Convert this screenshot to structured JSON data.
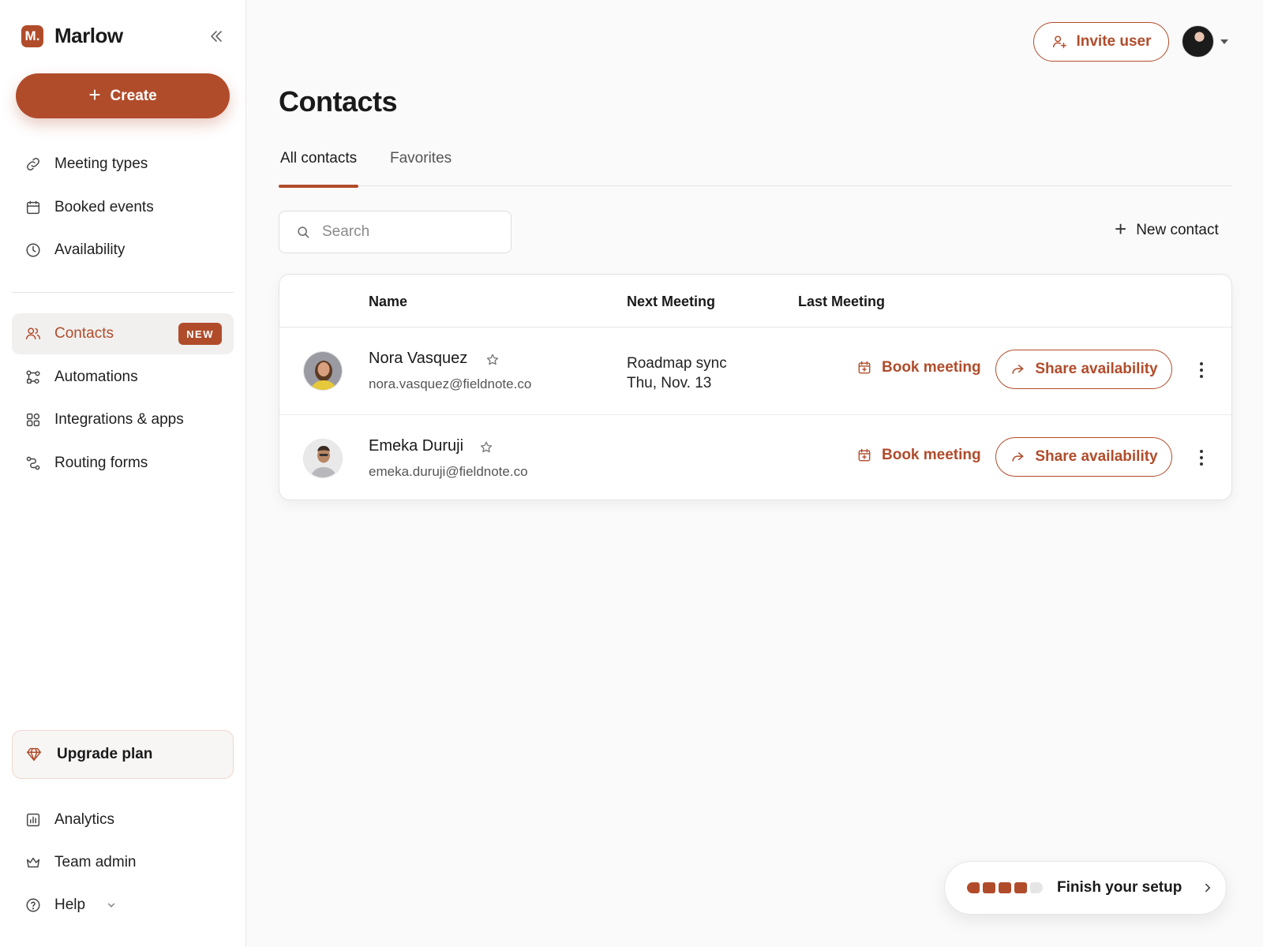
{
  "brand": {
    "logo_letter": "M.",
    "name": "Marlow"
  },
  "sidebar": {
    "create_label": "Create",
    "nav_top": [
      {
        "label": "Meeting types",
        "icon": "link-icon"
      },
      {
        "label": "Booked events",
        "icon": "calendar-icon"
      },
      {
        "label": "Availability",
        "icon": "clock-icon"
      }
    ],
    "nav_main": [
      {
        "label": "Contacts",
        "icon": "users-icon",
        "badge": "NEW",
        "active": true
      },
      {
        "label": "Automations",
        "icon": "workflow-icon"
      },
      {
        "label": "Integrations & apps",
        "icon": "apps-grid-icon"
      },
      {
        "label": "Routing forms",
        "icon": "routing-icon"
      }
    ],
    "upgrade_label": "Upgrade plan",
    "nav_bottom": [
      {
        "label": "Analytics",
        "icon": "chart-icon"
      },
      {
        "label": "Team admin",
        "icon": "crown-icon"
      },
      {
        "label": "Help",
        "icon": "help-circle-icon"
      }
    ]
  },
  "header": {
    "invite_label": "Invite user"
  },
  "page": {
    "title": "Contacts",
    "tabs": [
      {
        "label": "All contacts",
        "active": true
      },
      {
        "label": "Favorites",
        "active": false
      }
    ],
    "search_placeholder": "Search",
    "new_contact_label": "New contact"
  },
  "table": {
    "columns": [
      "Name",
      "Next Meeting",
      "Last Meeting"
    ],
    "rows": [
      {
        "name": "Nora Vasquez",
        "email": "nora.vasquez@fieldnote.co",
        "next_meeting_title": "Roadmap sync",
        "next_meeting_date": "Thu, Nov. 13",
        "last_meeting": "",
        "book_label": "Book meeting",
        "share_label": "Share availability"
      },
      {
        "name": "Emeka Duruji",
        "email": "emeka.duruji@fieldnote.co",
        "next_meeting_title": "",
        "next_meeting_date": "",
        "last_meeting": "",
        "book_label": "Book meeting",
        "share_label": "Share availability"
      }
    ]
  },
  "setup": {
    "label": "Finish your setup",
    "steps_done": 4,
    "steps_total": 5
  },
  "colors": {
    "accent": "#b14c2b",
    "background": "#fafafa",
    "sidebar_bg": "#ffffff"
  }
}
